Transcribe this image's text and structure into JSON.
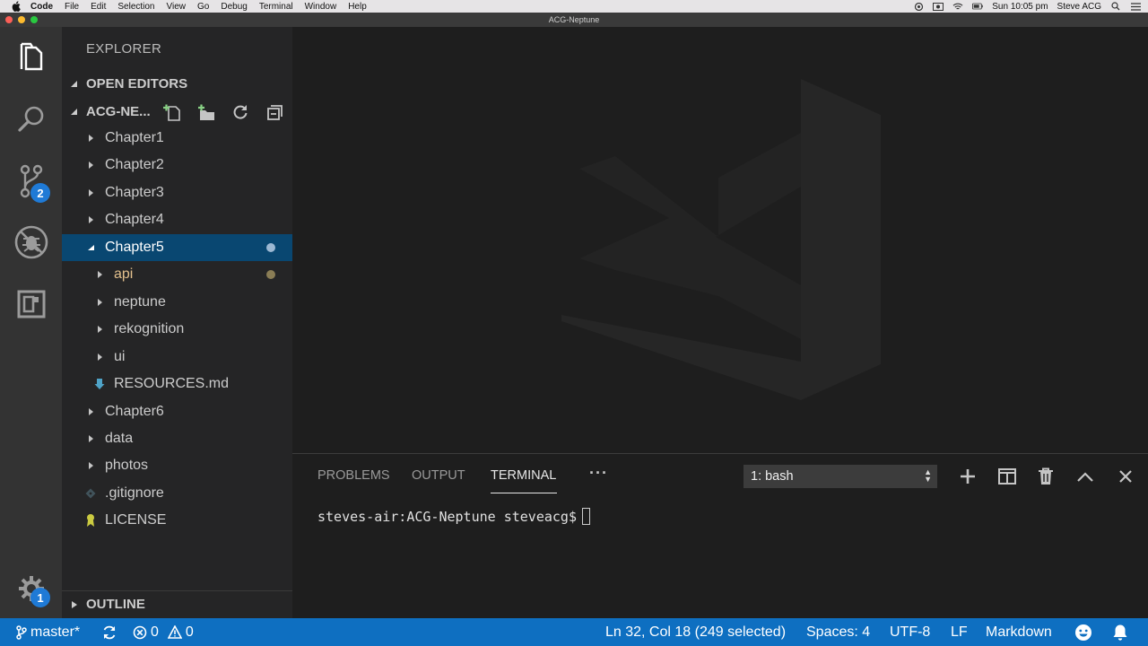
{
  "menubar": {
    "app_name": "Code",
    "menus": [
      "File",
      "Edit",
      "Selection",
      "View",
      "Go",
      "Debug",
      "Terminal",
      "Window",
      "Help"
    ],
    "clock": "Sun 10:05 pm",
    "user": "Steve ACG"
  },
  "window": {
    "title": "ACG-Neptune"
  },
  "activity_bar": {
    "scm_badge": "2",
    "settings_badge": "1"
  },
  "sidebar": {
    "title": "EXPLORER",
    "open_editors": "OPEN EDITORS",
    "folder_name": "ACG-NE...",
    "outline": "OUTLINE",
    "tree": [
      {
        "label": "Chapter1",
        "kind": "folder-collapsed"
      },
      {
        "label": "Chapter2",
        "kind": "folder-collapsed"
      },
      {
        "label": "Chapter3",
        "kind": "folder-collapsed"
      },
      {
        "label": "Chapter4",
        "kind": "folder-collapsed"
      },
      {
        "label": "Chapter5",
        "kind": "folder-expanded",
        "selected": true,
        "modified": true
      },
      {
        "label": "api",
        "kind": "folder-collapsed",
        "modified": true,
        "color": "#e2c08d"
      },
      {
        "label": "neptune",
        "kind": "folder-collapsed"
      },
      {
        "label": "rekognition",
        "kind": "folder-collapsed"
      },
      {
        "label": "ui",
        "kind": "folder-collapsed"
      },
      {
        "label": "RESOURCES.md",
        "kind": "markdown-file"
      },
      {
        "label": "Chapter6",
        "kind": "folder-collapsed"
      },
      {
        "label": "data",
        "kind": "folder-collapsed"
      },
      {
        "label": "photos",
        "kind": "folder-collapsed"
      },
      {
        "label": ".gitignore",
        "kind": "git-file"
      },
      {
        "label": "LICENSE",
        "kind": "license-file"
      }
    ]
  },
  "panel": {
    "tabs": [
      "PROBLEMS",
      "OUTPUT",
      "TERMINAL"
    ],
    "active_tab": "TERMINAL",
    "more": "···",
    "terminal_select": "1: bash",
    "prompt": "steves-air:ACG-Neptune steveacg$"
  },
  "status_bar": {
    "branch": "master*",
    "errors": "0",
    "warnings": "0",
    "cursor": "Ln 32, Col 18 (249 selected)",
    "indent": "Spaces: 4",
    "encoding": "UTF-8",
    "eol": "LF",
    "language": "Markdown"
  },
  "colors": {
    "status_bar": "#0e6fc1",
    "selection": "#094771",
    "badge": "#1f7ad6",
    "modified_folder": "#e2c08d"
  }
}
